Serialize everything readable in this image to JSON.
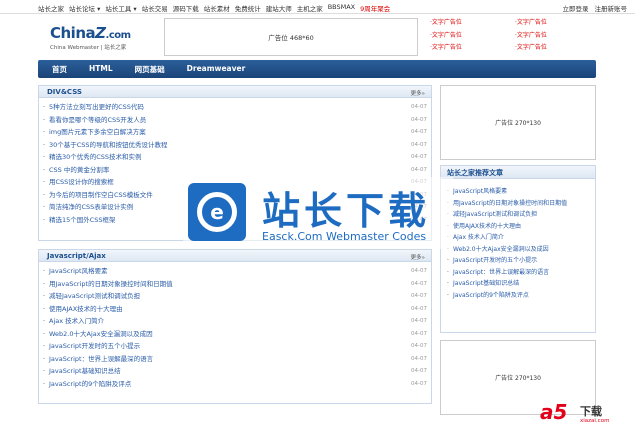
{
  "topbar": {
    "nav": [
      "站长之家",
      "站长论坛 ▾",
      "站长工具 ▾",
      "站长交易",
      "源码下载",
      "站长素材",
      "免费统计",
      "建站大师",
      "主机之家",
      "BBSMAX"
    ],
    "promo": "9周年聚会",
    "login": "立即登录",
    "register": "注册新账号"
  },
  "logo": {
    "name_a": "China",
    "name_z": "Z",
    "name_b": ".com",
    "tagline": "China Webmaster | 站长之家"
  },
  "ad_top": "广告位 468*60",
  "text_ads": [
    "·文字广告位",
    "·文字广告位",
    "·文字广告位",
    "·文字广告位",
    "·文字广告位",
    "·文字广告位"
  ],
  "nav": [
    "首页",
    "HTML",
    "网页基础",
    "Dreamweaver"
  ],
  "panel1": {
    "title": "DIV&CSS",
    "more": "更多»",
    "items": [
      {
        "t": "5种方法立刻写出更好的CSS代码",
        "d": "04-07"
      },
      {
        "t": "看看你是哪个等级的CSS开发人员",
        "d": "04-07"
      },
      {
        "t": "img图片元素下多余空白解决方案",
        "d": "04-07"
      },
      {
        "t": "30个基于CSS的导航和按钮优秀设计教程",
        "d": "04-07"
      },
      {
        "t": "精选30个优秀的CSS技术和实例",
        "d": "04-07"
      },
      {
        "t": "CSS 中的黄金分割率",
        "d": "04-07"
      },
      {
        "t": "用CSS设计你的搜索框",
        "d": "04-07"
      },
      {
        "t": "为今后的项目制作空白CSS模板文件",
        "d": "04-07"
      },
      {
        "t": "简洁纯净的CSS表单设计实例",
        "d": "04-07"
      },
      {
        "t": "精选15个国外CSS框架",
        "d": "04-07"
      }
    ]
  },
  "panel2": {
    "title": "Javascript/Ajax",
    "more": "更多»",
    "items": [
      {
        "t": "JavaScript风格要素",
        "d": "04-07"
      },
      {
        "t": "用JavaScript的日期对象操控时间和日期值",
        "d": "04-07"
      },
      {
        "t": "减轻JavaScript测试和调试负担",
        "d": "04-07"
      },
      {
        "t": "使用AJAX技术的十大理由",
        "d": "04-07"
      },
      {
        "t": "Ajax 技术入门简介",
        "d": "04-07"
      },
      {
        "t": "Web2.0十大Ajax安全漏洞以及成因",
        "d": "04-07"
      },
      {
        "t": "JavaScript开发时的五个小提示",
        "d": "04-07"
      },
      {
        "t": "JavaScript：世界上误解最深的语言",
        "d": "04-07"
      },
      {
        "t": "JavaScript基础知识总结",
        "d": "04-07"
      },
      {
        "t": "JavaScript的9个陷阱及评点",
        "d": "04-07"
      }
    ]
  },
  "side_ad_1": "广告位 270*130",
  "side_ad_2": "广告位 270*130",
  "recommend": {
    "title": "站长之家推荐文章",
    "items": [
      "JavaScript风格要素",
      "用JavaScript的日期对象操控时间和日期值",
      "减轻JavaScript测试和调试负担",
      "使用AJAX技术的十大理由",
      "Ajax 技术入门简介",
      "Web2.0十大Ajax安全漏洞以及成因",
      "JavaScript开发时的五个小提示",
      "JavaScript：世界上误解最深的语言",
      "JavaScript基础知识总结",
      "JavaScript的9个陷阱及评点"
    ]
  },
  "watermark": {
    "title": "站长下载",
    "subtitle": "Easck.Com Webmaster Codes",
    "icon": "e-circle-icon"
  },
  "corner_logo": {
    "mark": "a5",
    "text": "下载",
    "url": "xiazai.com"
  },
  "colors": {
    "brand_blue": "#1c4f8f",
    "nav_blue": "#2c5f9b",
    "link_blue": "#2a5ca8",
    "ad_red": "#d00000",
    "watermark_blue": "#1e6cc2"
  }
}
